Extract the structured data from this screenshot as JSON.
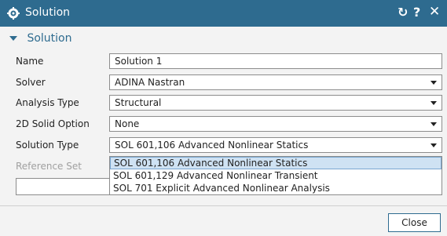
{
  "window": {
    "title": "Solution"
  },
  "section": {
    "title": "Solution"
  },
  "form": {
    "name": {
      "label": "Name",
      "value": "Solution 1"
    },
    "solver": {
      "label": "Solver",
      "value": "ADINA Nastran"
    },
    "analysis_type": {
      "label": "Analysis Type",
      "value": "Structural"
    },
    "solid_option": {
      "label": "2D Solid Option",
      "value": "None"
    },
    "solution_type": {
      "label": "Solution Type",
      "value": "SOL 601,106 Advanced Nonlinear Statics",
      "options": [
        "SOL 601,106 Advanced Nonlinear Statics",
        "SOL 601,129 Advanced Nonlinear Transient",
        "SOL 701 Explicit Advanced Nonlinear Analysis"
      ]
    },
    "reference_set": {
      "label": "Reference Set"
    }
  },
  "footer": {
    "close_label": "Close"
  },
  "colors": {
    "accent": "#2e6b8f",
    "selection": "#cfe2f3"
  }
}
